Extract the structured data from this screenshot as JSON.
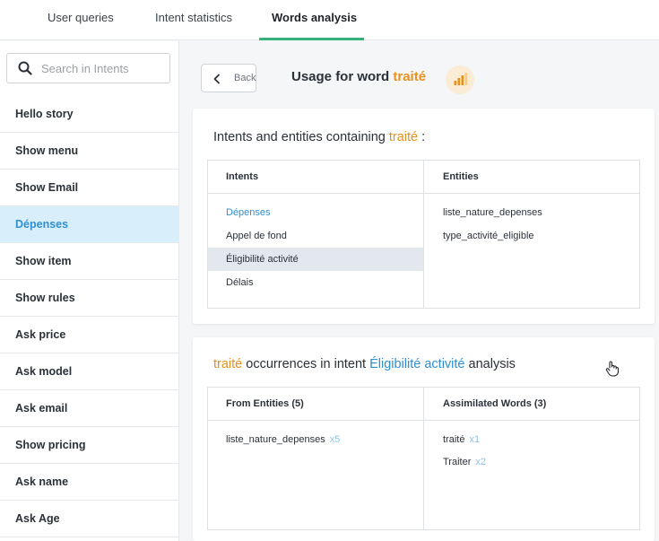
{
  "tabs": [
    {
      "label": "User queries"
    },
    {
      "label": "Intent statistics"
    },
    {
      "label": "Words analysis"
    }
  ],
  "sidebar": {
    "search_placeholder": "Search in Intents",
    "items": [
      {
        "label": "Hello story"
      },
      {
        "label": "Show menu"
      },
      {
        "label": "Show Email"
      },
      {
        "label": "Dépenses"
      },
      {
        "label": "Show item"
      },
      {
        "label": "Show rules"
      },
      {
        "label": "Ask price"
      },
      {
        "label": "Ask model"
      },
      {
        "label": "Ask email"
      },
      {
        "label": "Show pricing"
      },
      {
        "label": "Ask name"
      },
      {
        "label": "Ask Age"
      }
    ],
    "selected_index": 3
  },
  "header": {
    "back_label": "Back",
    "title_prefix": "Usage for word",
    "word": "traité",
    "signal_icon": "signal-bars-icon"
  },
  "containing_card": {
    "title_prefix": "Intents and entities containing",
    "word": "traité",
    "title_suffix": ":",
    "col_intents": "Intents",
    "col_entities": "Entities",
    "intents": [
      "Dépenses",
      "Appel de fond",
      "Éligibilité activité",
      "Délais"
    ],
    "entities": [
      "liste_nature_depenses",
      "type_activité_eligible"
    ]
  },
  "occurrence_card": {
    "word": "traité",
    "title_mid": "occurrences in intent",
    "intent": "Éligibilité activité",
    "title_suffix": "analysis",
    "col_entities": "From Entities (5)",
    "col_words": "Assimilated Words (3)",
    "entities": [
      {
        "name": "liste_nature_depenses",
        "count": "x5"
      }
    ],
    "words": [
      {
        "name": "traité",
        "count": "x1"
      },
      {
        "name": "Traiter",
        "count": "x2"
      }
    ]
  },
  "colors": {
    "accent_green": "#35b17c",
    "accent_orange": "#e8901c",
    "link_blue": "#2f8fd1",
    "selected_bg": "#d9eefb"
  }
}
